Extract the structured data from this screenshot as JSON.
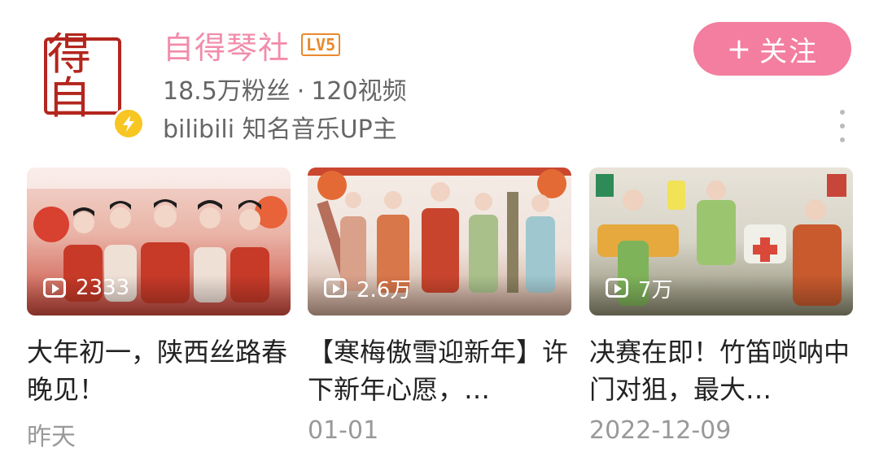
{
  "channel": {
    "name": "自得琴社",
    "level": "LV5",
    "followers": "18.5万粉丝",
    "separator": "·",
    "videos": "120视频",
    "description": "bilibili 知名音乐UP主",
    "avatar_glyphs": "得自",
    "follow_label": "关注",
    "follow_plus": "+"
  },
  "videos": [
    {
      "plays": "2333",
      "title": "大年初一，陕西丝路春晚见！",
      "date": "昨天"
    },
    {
      "plays": "2.6万",
      "title": "【寒梅傲雪迎新年】许下新年心愿，…",
      "date": "01-01"
    },
    {
      "plays": "7万",
      "title": "决赛在即！竹笛唢呐中门对狙，最大…",
      "date": "2022-12-09"
    }
  ],
  "colors": {
    "accent_pink": "#f37ea0",
    "name_pink": "#f28cab",
    "level_orange": "#e9892c",
    "verify_yellow": "#f7c623",
    "seal_red": "#b3261e"
  },
  "icons": [
    "verified-icon",
    "play-icon",
    "more-icon"
  ]
}
